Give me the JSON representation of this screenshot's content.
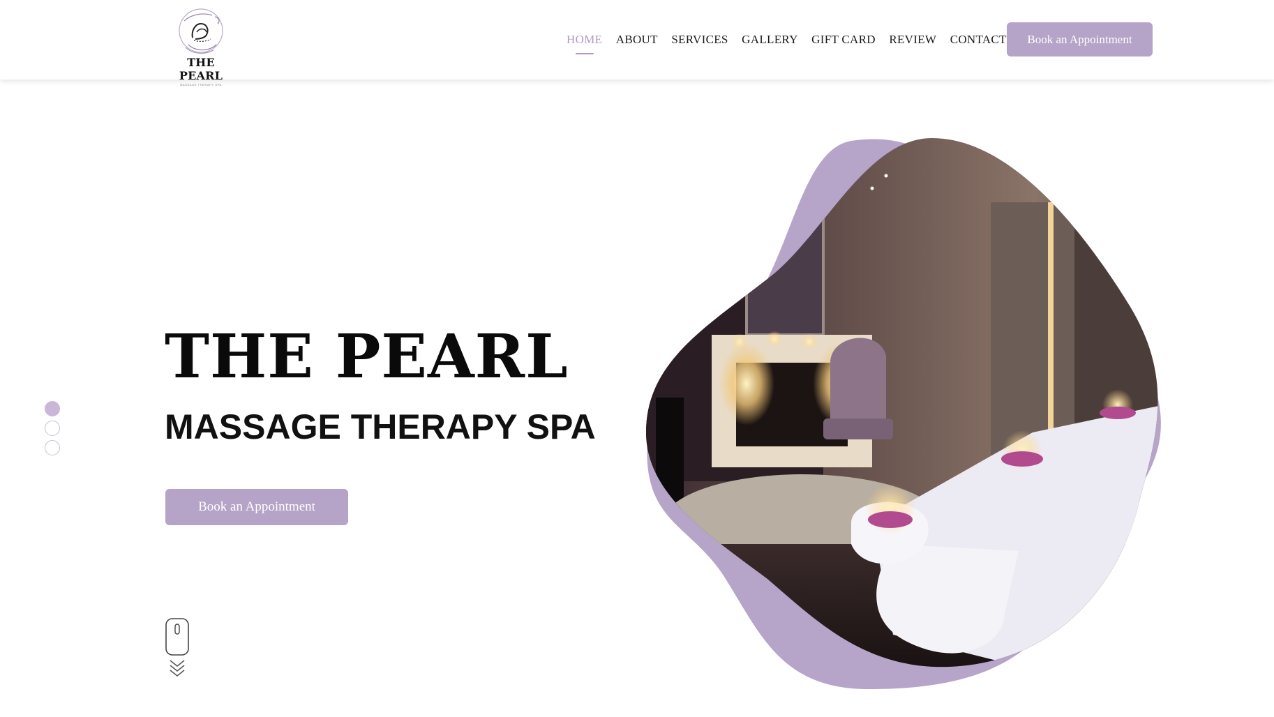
{
  "brand": {
    "name": "THE PEARL",
    "tagline": "MASSAGE THERAPY SPA",
    "logo_icon": "hands-massage-logo"
  },
  "nav": {
    "items": [
      {
        "label": "HOME",
        "active": true
      },
      {
        "label": "ABOUT",
        "active": false
      },
      {
        "label": "SERVICES",
        "active": false
      },
      {
        "label": "GALLERY",
        "active": false
      },
      {
        "label": "GIFT CARD",
        "active": false
      },
      {
        "label": "REVIEW",
        "active": false
      },
      {
        "label": "CONTACT",
        "active": false
      }
    ],
    "cta_label": "Book an Appointment"
  },
  "hero": {
    "title": "THE PEARL",
    "subtitle": "MASSAGE THERAPY SPA",
    "cta_label": "Book an Appointment",
    "slider": {
      "count": 3,
      "active_index": 0
    },
    "scroll_icon": "mouse-scroll-icon",
    "image": "spa-treatment-room-photo"
  },
  "colors": {
    "accent": "#b5a3c8",
    "accent_dark": "#b19bc6",
    "text": "#111111",
    "background": "#ffffff"
  }
}
